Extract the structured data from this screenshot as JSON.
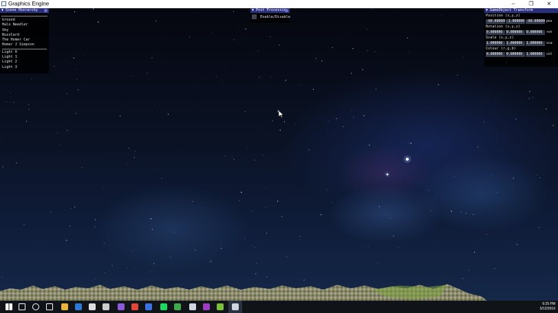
{
  "window": {
    "title": "Graphics Engine",
    "minimize_glyph": "–",
    "maximize_glyph": "❐",
    "close_glyph": "✕"
  },
  "scene_hierarchy": {
    "title": "Scene Hierarchy",
    "objects": [
      "Ground",
      "Halo Needler",
      "Sky",
      "BuzzCard",
      "The Homer Car",
      "Homer J Simpson"
    ],
    "lights": [
      "Light 0",
      "Light 1",
      "Light 2",
      "Light 3"
    ]
  },
  "post_processing": {
    "title": "Post Processin",
    "toggle_label": "Enable/Disable"
  },
  "transform": {
    "title": "GameObject Transform",
    "position": {
      "label": "Position (x,y,z)",
      "values": [
        "-60.000000",
        "-1.000000",
        "-60.000000"
      ],
      "suffix": "pos"
    },
    "rotation": {
      "label": "Rotation (x,y,z)",
      "values": [
        "0.000000",
        "0.000000",
        "0.000000"
      ],
      "suffix": "rot"
    },
    "scale": {
      "label": "Scale (x,y,z)",
      "values": [
        "1.000000",
        "1.000000",
        "1.000000"
      ],
      "suffix": "sca"
    },
    "colour": {
      "label": "Colour (r,g,b)",
      "values": [
        "0.000000",
        "0.000000",
        "1.000000"
      ],
      "suffix": "col"
    }
  },
  "taskbar": {
    "time": "6:25 PM",
    "date": "5/12/2019",
    "apps": [
      "start-icon",
      "search-icon",
      "cortana-icon",
      "task-view-icon",
      "file-explorer-icon",
      "edge-icon",
      "store-icon",
      "mail-icon",
      "visual-studio-icon",
      "chrome-icon",
      "app-blue-icon",
      "spotify-icon",
      "app-green-icon",
      "steam-icon",
      "premiere-icon",
      "app-notepad-icon",
      "graphics-engine-icon"
    ]
  },
  "colors": {
    "panel_header": "#2a2f7a",
    "field_bg": "#333a4a",
    "taskbar": "#101318"
  }
}
